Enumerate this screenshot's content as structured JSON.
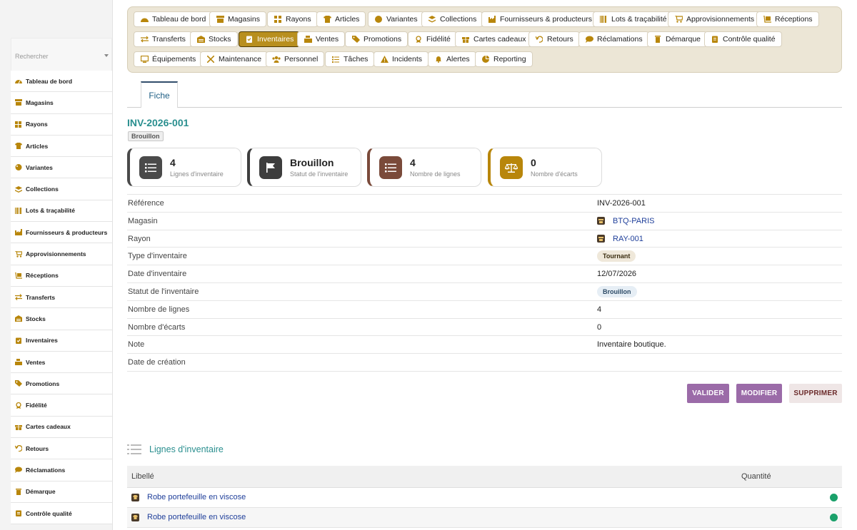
{
  "sidebar": {
    "search_placeholder": "Rechercher",
    "items": [
      {
        "label": "Tableau de bord",
        "icon": "dashboard-icon"
      },
      {
        "label": "Magasins",
        "icon": "store-icon"
      },
      {
        "label": "Rayons",
        "icon": "grid-icon"
      },
      {
        "label": "Articles",
        "icon": "shirt-icon"
      },
      {
        "label": "Variantes",
        "icon": "palette-icon"
      },
      {
        "label": "Collections",
        "icon": "layers-icon"
      },
      {
        "label": "Lots & traçabilité",
        "icon": "barcode-icon"
      },
      {
        "label": "Fournisseurs & producteurs",
        "icon": "industry-icon"
      },
      {
        "label": "Approvisionnements",
        "icon": "cart-icon"
      },
      {
        "label": "Réceptions",
        "icon": "dolly-icon"
      },
      {
        "label": "Transferts",
        "icon": "transfer-icon"
      },
      {
        "label": "Stocks",
        "icon": "warehouse-icon"
      },
      {
        "label": "Inventaires",
        "icon": "clipboard-check-icon"
      },
      {
        "label": "Ventes",
        "icon": "cash-register-icon"
      },
      {
        "label": "Promotions",
        "icon": "tags-icon"
      },
      {
        "label": "Fidélité",
        "icon": "award-icon"
      },
      {
        "label": "Cartes cadeaux",
        "icon": "gift-icon"
      },
      {
        "label": "Retours",
        "icon": "undo-icon"
      },
      {
        "label": "Réclamations",
        "icon": "comment-icon"
      },
      {
        "label": "Démarque",
        "icon": "trash-icon"
      },
      {
        "label": "Contrôle qualité",
        "icon": "clipboard-icon"
      }
    ]
  },
  "topmenu": {
    "row1": [
      "Tableau de bord",
      "Magasins",
      "Rayons",
      "Articles",
      "Variantes",
      "Collections",
      "Fournisseurs & producteurs",
      "Lots & traçabilité",
      "Approvisionnements",
      "Réceptions"
    ],
    "row2": [
      "Transferts",
      "Stocks",
      "Inventaires",
      "Ventes",
      "Promotions",
      "Fidélité",
      "Cartes cadeaux",
      "Retours",
      "Réclamations",
      "Démarque",
      "Contrôle qualité"
    ],
    "row3": [
      "Équipements",
      "Maintenance",
      "Personnel",
      "Tâches",
      "Incidents",
      "Alertes",
      "Reporting"
    ],
    "active": "Inventaires"
  },
  "tabs": {
    "fiche": "Fiche"
  },
  "record": {
    "title": "INV-2026-001",
    "status_badge": "Brouillon"
  },
  "cards": [
    {
      "value": "4",
      "label": "Lignes d'inventaire",
      "icon": "list-icon",
      "color": "#4a4a4a"
    },
    {
      "value": "Brouillon",
      "label": "Statut de l'inventaire",
      "icon": "flag-icon",
      "color": "#3d3d3d"
    },
    {
      "value": "4",
      "label": "Nombre de lignes",
      "icon": "list-icon",
      "color": "#7a4a3a"
    },
    {
      "value": "0",
      "label": "Nombre d'écarts",
      "icon": "balance-icon",
      "color": "#b8860b"
    }
  ],
  "details": {
    "reference": {
      "label": "Référence",
      "value": "INV-2026-001"
    },
    "magasin": {
      "label": "Magasin",
      "value": "BTQ-PARIS"
    },
    "rayon": {
      "label": "Rayon",
      "value": "RAY-001"
    },
    "type": {
      "label": "Type d'inventaire",
      "value": "Tournant"
    },
    "date": {
      "label": "Date d'inventaire",
      "value": "12/07/2026"
    },
    "statut": {
      "label": "Statut de l'inventaire",
      "value": "Brouillon"
    },
    "nb_lignes": {
      "label": "Nombre de lignes",
      "value": "4"
    },
    "nb_ecarts": {
      "label": "Nombre d'écarts",
      "value": "0"
    },
    "note": {
      "label": "Note",
      "value": "Inventaire boutique."
    },
    "date_creation": {
      "label": "Date de création",
      "value": ""
    }
  },
  "actions": {
    "valider": "VALIDER",
    "modifier": "MODIFIER",
    "supprimer": "SUPPRIMER"
  },
  "lines_section": {
    "title": "Lignes d'inventaire",
    "headers": {
      "libelle": "Libellé",
      "quantite": "Quantité"
    },
    "rows": [
      {
        "libelle": "Robe portefeuille en viscose",
        "status_color": "#1aa06a"
      },
      {
        "libelle": "Robe portefeuille en viscose",
        "status_color": "#1aa06a"
      }
    ]
  },
  "colors": {
    "accent_gold": "#b88f1e",
    "teal": "#2a8f8f",
    "purple_button": "#9b6ba8"
  }
}
